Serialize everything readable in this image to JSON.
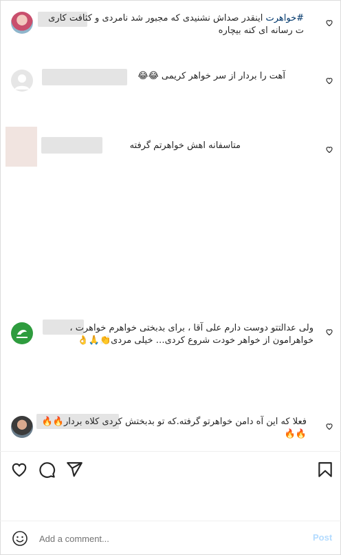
{
  "comments": [
    {
      "text_hashtag": "#خواهرت",
      "text": " اینقدر صداش نشنیدی که مجبور شد نامردی و کثافت کاری ت رسانه ای کنه بیچاره"
    },
    {
      "text": "آهت را بردار از سر خواهر کریمی 😂😂"
    },
    {
      "text": "متاسفانه اهش خواهرتم گرفته"
    },
    {
      "text": "ولی عدالتتو دوست دارم علی آقا ، برای بدبختی خواهرم خواهرت ، خواهرامون از خواهر خودت شروع کردی… خیلی مردی👏🙏👌"
    },
    {
      "text": "فعلا که این آه دامن خواهرتو گرفته.که تو بدبختش کردی کلاه بردار🔥🔥🔥🔥"
    }
  ],
  "footer": {
    "comment_placeholder": "Add a comment...",
    "post_label": "Post"
  },
  "icons": {
    "like": "heart-icon",
    "comment": "comment-icon",
    "share": "send-icon",
    "save": "bookmark-icon",
    "emoji": "emoji-icon"
  },
  "colors": {
    "hashtag": "#00376b",
    "post_disabled": "#b3dbff",
    "placeholder": "#737373"
  }
}
